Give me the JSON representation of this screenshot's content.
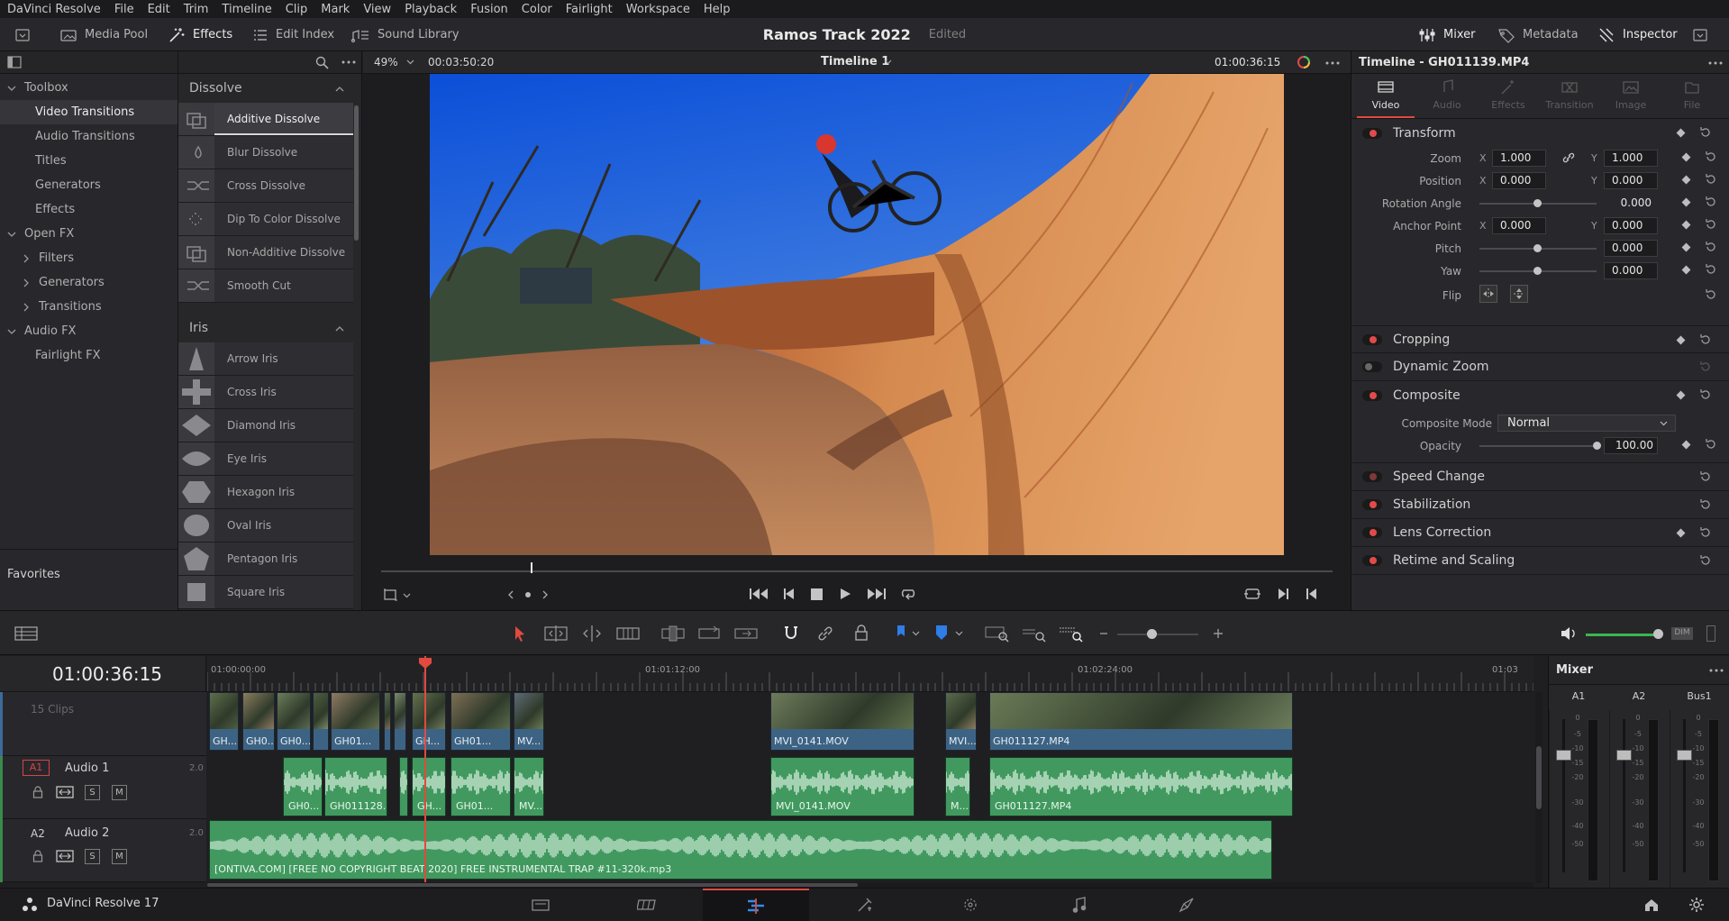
{
  "app": {
    "name": "DaVinci Resolve",
    "version_label": "DaVinci Resolve 17"
  },
  "menu": [
    "DaVinci Resolve",
    "File",
    "Edit",
    "Trim",
    "Timeline",
    "Clip",
    "Mark",
    "View",
    "Playback",
    "Fusion",
    "Color",
    "Fairlight",
    "Workspace",
    "Help"
  ],
  "toolbar": {
    "media_pool": "Media Pool",
    "effects": "Effects",
    "edit_index": "Edit Index",
    "sound_library": "Sound Library",
    "mixer": "Mixer",
    "metadata": "Metadata",
    "inspector": "Inspector"
  },
  "project": {
    "title": "Ramos Track 2022",
    "status": "Edited"
  },
  "toolbox": {
    "items": [
      {
        "label": "Toolbox",
        "level": 0,
        "arrow": "down"
      },
      {
        "label": "Video Transitions",
        "level": 1,
        "selected": true
      },
      {
        "label": "Audio Transitions",
        "level": 1
      },
      {
        "label": "Titles",
        "level": 1
      },
      {
        "label": "Generators",
        "level": 1
      },
      {
        "label": "Effects",
        "level": 1
      },
      {
        "label": "Open FX",
        "level": 0,
        "arrow": "down"
      },
      {
        "label": "Filters",
        "level": 1,
        "arrow": "right"
      },
      {
        "label": "Generators",
        "level": 1,
        "arrow": "right"
      },
      {
        "label": "Transitions",
        "level": 1,
        "arrow": "right"
      },
      {
        "label": "Audio FX",
        "level": 0,
        "arrow": "down"
      },
      {
        "label": "Fairlight FX",
        "level": 1
      }
    ],
    "favorites": "Favorites"
  },
  "effects_list": {
    "groups": [
      {
        "name": "Dissolve",
        "items": [
          "Additive Dissolve",
          "Blur Dissolve",
          "Cross Dissolve",
          "Dip To Color Dissolve",
          "Non-Additive Dissolve",
          "Smooth Cut"
        ]
      },
      {
        "name": "Iris",
        "items": [
          "Arrow Iris",
          "Cross Iris",
          "Diamond Iris",
          "Eye Iris",
          "Hexagon Iris",
          "Oval Iris",
          "Pentagon Iris",
          "Square Iris"
        ]
      }
    ],
    "selected": "Additive Dissolve"
  },
  "viewer": {
    "zoom": "49%",
    "duration": "00:03:50:20",
    "timeline_name": "Timeline 1",
    "timecode": "01:00:36:15",
    "scrub_position": 0.157
  },
  "inspector": {
    "title": "Timeline - GH011139.MP4",
    "tabs": [
      {
        "label": "Video",
        "active": true
      },
      {
        "label": "Audio"
      },
      {
        "label": "Effects"
      },
      {
        "label": "Transition"
      },
      {
        "label": "Image"
      },
      {
        "label": "File"
      }
    ],
    "transform": {
      "title": "Transform",
      "zoom_label": "Zoom",
      "zoom_x": "1.000",
      "zoom_y": "1.000",
      "position_label": "Position",
      "position_x": "0.000",
      "position_y": "0.000",
      "rotation_label": "Rotation Angle",
      "rotation": "0.000",
      "anchor_label": "Anchor Point",
      "anchor_x": "0.000",
      "anchor_y": "0.000",
      "pitch_label": "Pitch",
      "pitch": "0.000",
      "yaw_label": "Yaw",
      "yaw": "0.000",
      "flip_label": "Flip",
      "x_axis": "X",
      "y_axis": "Y"
    },
    "sections": {
      "cropping": "Cropping",
      "dynamic_zoom": "Dynamic Zoom",
      "composite": "Composite",
      "speed_change": "Speed Change",
      "stabilization": "Stabilization",
      "lens_correction": "Lens Correction",
      "retime_scaling": "Retime and Scaling"
    },
    "composite": {
      "mode_label": "Composite Mode",
      "mode_value": "Normal",
      "opacity_label": "Opacity",
      "opacity": "100.00"
    }
  },
  "timeline": {
    "timecode": "01:00:36:15",
    "ruler": [
      "01:00:00:00",
      "01:01:12:00",
      "01:02:24:00",
      "01:03"
    ],
    "clip_count": "15 Clips",
    "video_clips": [
      "GH...",
      "GH0...",
      "GH0...",
      "GH01...",
      "GH...",
      "GH01...",
      "MV...",
      "MVI_0141.MOV",
      "MVI...",
      "GH011127.MP4"
    ],
    "tracks": [
      {
        "id": "A1",
        "name": "Audio 1",
        "ch": "2.0"
      },
      {
        "id": "A2",
        "name": "Audio 2",
        "ch": "2.0"
      }
    ],
    "track_btn": {
      "s": "S",
      "m": "M"
    },
    "audio1_clips": [
      "GH0...",
      "GH011128...",
      "GH...",
      "GH01...",
      "MV...",
      "MVI_0141.MOV",
      "M...",
      "GH011127.MP4"
    ],
    "audio2_clip": "[ONTIVA.COM] [FREE NO COPYRIGHT BEAT 2020] FREE INSTRUMENTAL TRAP #11-320k.mp3",
    "playhead_fraction": 0.164
  },
  "mixer": {
    "title": "Mixer",
    "channels": [
      "A1",
      "A2",
      "Bus1"
    ],
    "scale": [
      "0",
      "-5",
      "-10",
      "-15",
      "-20",
      "-30",
      "-40",
      "-50"
    ],
    "dim": "DIM"
  }
}
